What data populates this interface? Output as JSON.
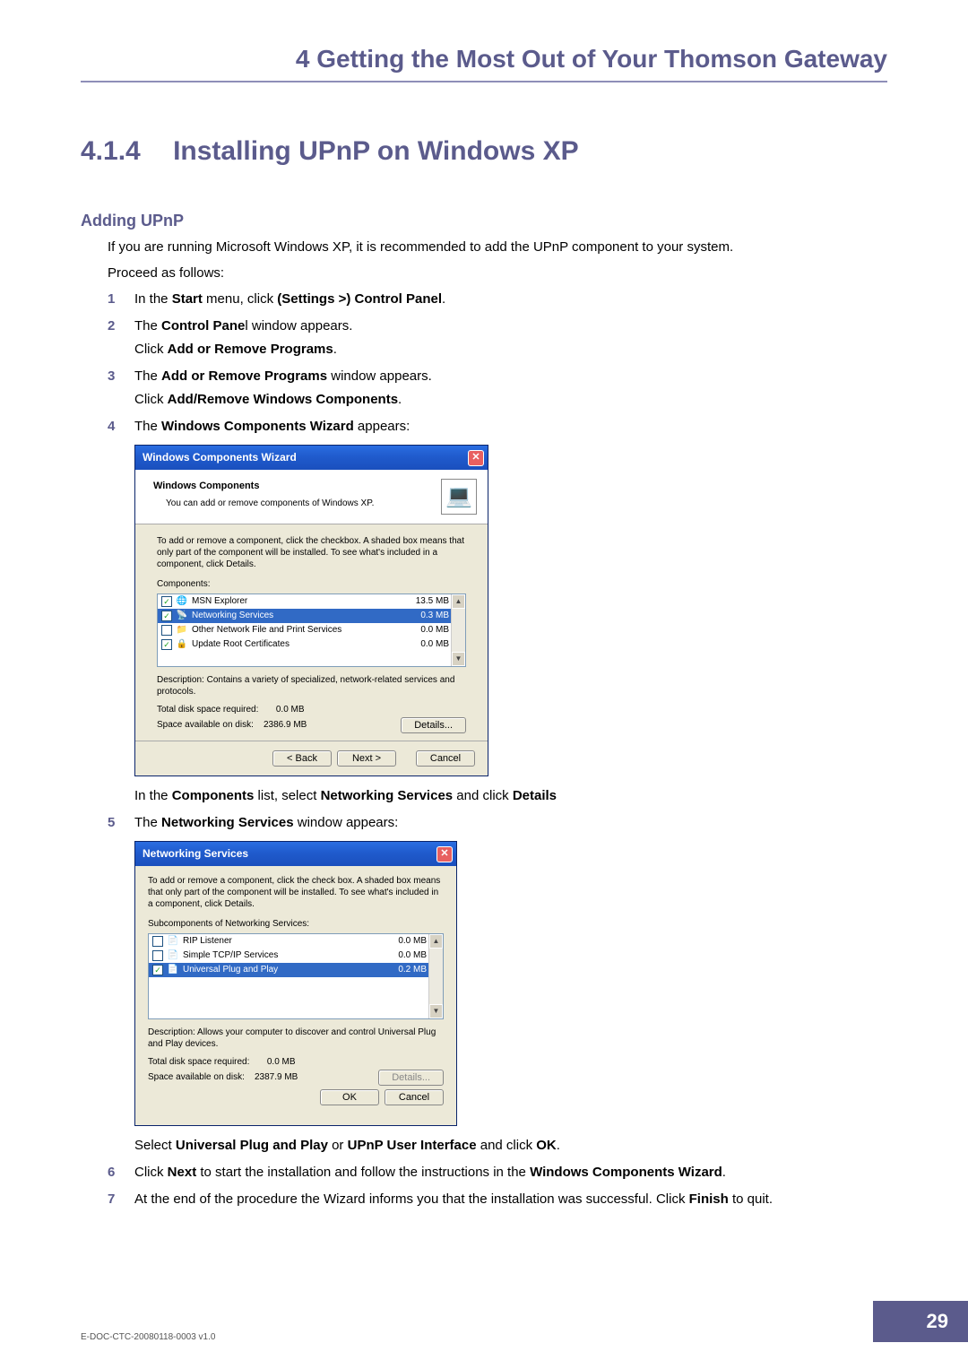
{
  "chapter": {
    "num": "4",
    "title": "Getting the Most Out of Your Thomson Gateway"
  },
  "section": {
    "num": "4.1.4",
    "title": "Installing UPnP on Windows XP"
  },
  "subhead1": "Adding UPnP",
  "intro1": "If you are running Microsoft Windows XP, it is recommended to add the UPnP component to your system.",
  "intro2": "Proceed as follows:",
  "steps": {
    "s1": {
      "pre": "In the ",
      "b1": "Start",
      "mid": " menu, click ",
      "b2": "(Settings >) Control Panel",
      "post": "."
    },
    "s2": {
      "pre": "The ",
      "b1": "Control Pane",
      "mid": "l window appears.",
      "sub_pre": "Click ",
      "sub_b": "Add or Remove Programs",
      "sub_post": "."
    },
    "s3": {
      "pre": "The ",
      "b1": "Add or Remove Programs",
      "mid": " window appears.",
      "sub_pre": "Click ",
      "sub_b": "Add/Remove Windows Components",
      "sub_post": "."
    },
    "s4": {
      "pre": "The ",
      "b1": "Windows Components Wizard",
      "mid": " appears:",
      "after_pre": "In the ",
      "after_b1": "Components",
      "after_mid": " list, select ",
      "after_b2": "Networking Services",
      "after_mid2": " and click ",
      "after_b3": "Details"
    },
    "s5": {
      "pre": "The ",
      "b1": "Networking Services",
      "mid": " window appears:",
      "after_pre": "Select ",
      "after_b1": "Universal Plug and Play",
      "after_mid": " or ",
      "after_b2": "UPnP User Interface",
      "after_mid2": " and click ",
      "after_b3": "OK",
      "after_post": "."
    },
    "s6": {
      "pre": "Click ",
      "b1": "Next",
      "mid": " to start the installation and follow the instructions in the ",
      "b2": "Windows Components Wizard",
      "post": "."
    },
    "s7": {
      "pre": "At the end of the procedure the Wizard informs you that the installation was successful. Click ",
      "b1": "Finish",
      "post": " to quit."
    }
  },
  "wiz1": {
    "title": "Windows Components Wizard",
    "head_title": "Windows Components",
    "head_sub": "You can add or remove components of Windows XP.",
    "instructions": "To add or remove a component, click the checkbox. A shaded box means that only part of the component will be installed. To see what's included in a component, click Details.",
    "components_label": "Components:",
    "rows": [
      {
        "checked": true,
        "name": "MSN Explorer",
        "size": "13.5 MB",
        "selected": false,
        "icon": "🌐"
      },
      {
        "checked": true,
        "name": "Networking Services",
        "size": "0.3 MB",
        "selected": true,
        "icon": "📡"
      },
      {
        "checked": false,
        "name": "Other Network File and Print Services",
        "size": "0.0 MB",
        "selected": false,
        "icon": "📁"
      },
      {
        "checked": true,
        "name": "Update Root Certificates",
        "size": "0.0 MB",
        "selected": false,
        "icon": "🔒"
      }
    ],
    "desc_label": "Description:",
    "desc": "Contains a variety of specialized, network-related services and protocols.",
    "req_label": "Total disk space required:",
    "req": "0.0 MB",
    "avail_label": "Space available on disk:",
    "avail": "2386.9 MB",
    "btn_details": "Details...",
    "btn_back": "< Back",
    "btn_next": "Next >",
    "btn_cancel": "Cancel"
  },
  "wiz2": {
    "title": "Networking Services",
    "instructions": "To add or remove a component, click the check box. A shaded box means that only part of the component will be installed. To see what's included in a component, click Details.",
    "sub_label": "Subcomponents of Networking Services:",
    "rows": [
      {
        "checked": false,
        "name": "RIP Listener",
        "size": "0.0 MB",
        "selected": false,
        "icon": "📄"
      },
      {
        "checked": false,
        "name": "Simple TCP/IP Services",
        "size": "0.0 MB",
        "selected": false,
        "icon": "📄"
      },
      {
        "checked": true,
        "name": "Universal Plug and Play",
        "size": "0.2 MB",
        "selected": true,
        "icon": "📄"
      }
    ],
    "desc_label": "Description:",
    "desc": "Allows your computer to discover and control Universal Plug and Play devices.",
    "req_label": "Total disk space required:",
    "req": "0.0 MB",
    "avail_label": "Space available on disk:",
    "avail": "2387.9 MB",
    "btn_details": "Details...",
    "btn_ok": "OK",
    "btn_cancel": "Cancel"
  },
  "footer": {
    "doc": "E-DOC-CTC-20080118-0003 v1.0",
    "page": "29"
  }
}
